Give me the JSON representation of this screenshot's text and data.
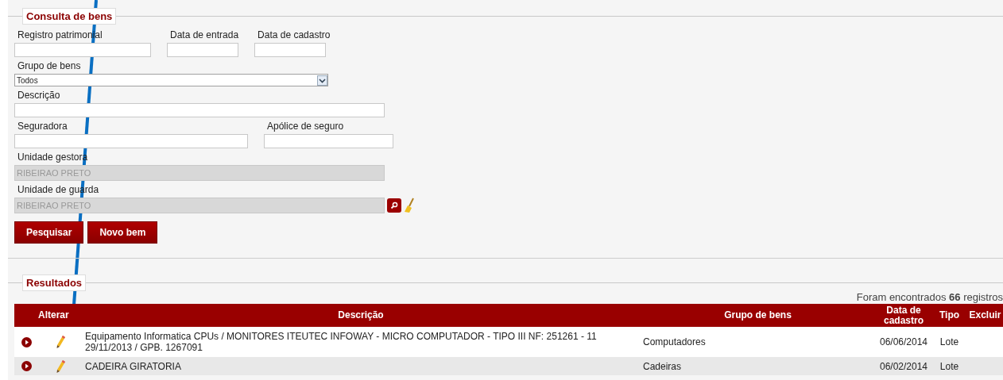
{
  "search_form": {
    "legend": "Consulta de bens",
    "fields": [
      {
        "label": "Registro patrimonial",
        "kind": "text",
        "disabled": false
      },
      {
        "label": "Data de entrada",
        "kind": "text",
        "disabled": false
      },
      {
        "label": "Data de cadastro",
        "kind": "text",
        "disabled": false
      },
      {
        "label": "Grupo de bens",
        "kind": "select",
        "value": "Todos",
        "disabled": false
      },
      {
        "label": "Descrição",
        "kind": "text",
        "disabled": false
      },
      {
        "label": "Seguradora",
        "kind": "text",
        "disabled": false
      },
      {
        "label": "Apólice de seguro",
        "kind": "text",
        "disabled": false
      },
      {
        "label": "Unidade gestora",
        "kind": "text",
        "value": "RIBEIRAO PRETO",
        "disabled": true
      },
      {
        "label": "Unidade de guarda",
        "kind": "lookup",
        "value": "RIBEIRAO PRETO",
        "disabled": true
      }
    ],
    "buttons": [
      "Pesquisar",
      "Novo bem"
    ]
  },
  "results": {
    "legend": "Resultados",
    "count_text": "Foram encontrados **66** registros",
    "table": {
      "columns": [
        "Alterar",
        "Descrição",
        "Grupo de bens",
        "Data de cadastro",
        "Tipo",
        "Excluir"
      ],
      "rows": [
        {
          "descricao": "Equipamento Informatica CPUs / MONITORES ITEUTEC INFOWAY - MICRO COMPUTADOR - TIPO III NF: 251261 - 11 29/11/2013 / GPB. 1267091",
          "grupo": "Computadores",
          "data": "06/06/2014",
          "tipo": "Lote"
        },
        {
          "descricao": "CADEIRA GIRATORIA",
          "grupo": "Cadeiras",
          "data": "06/02/2014",
          "tipo": "Lote"
        }
      ]
    }
  }
}
